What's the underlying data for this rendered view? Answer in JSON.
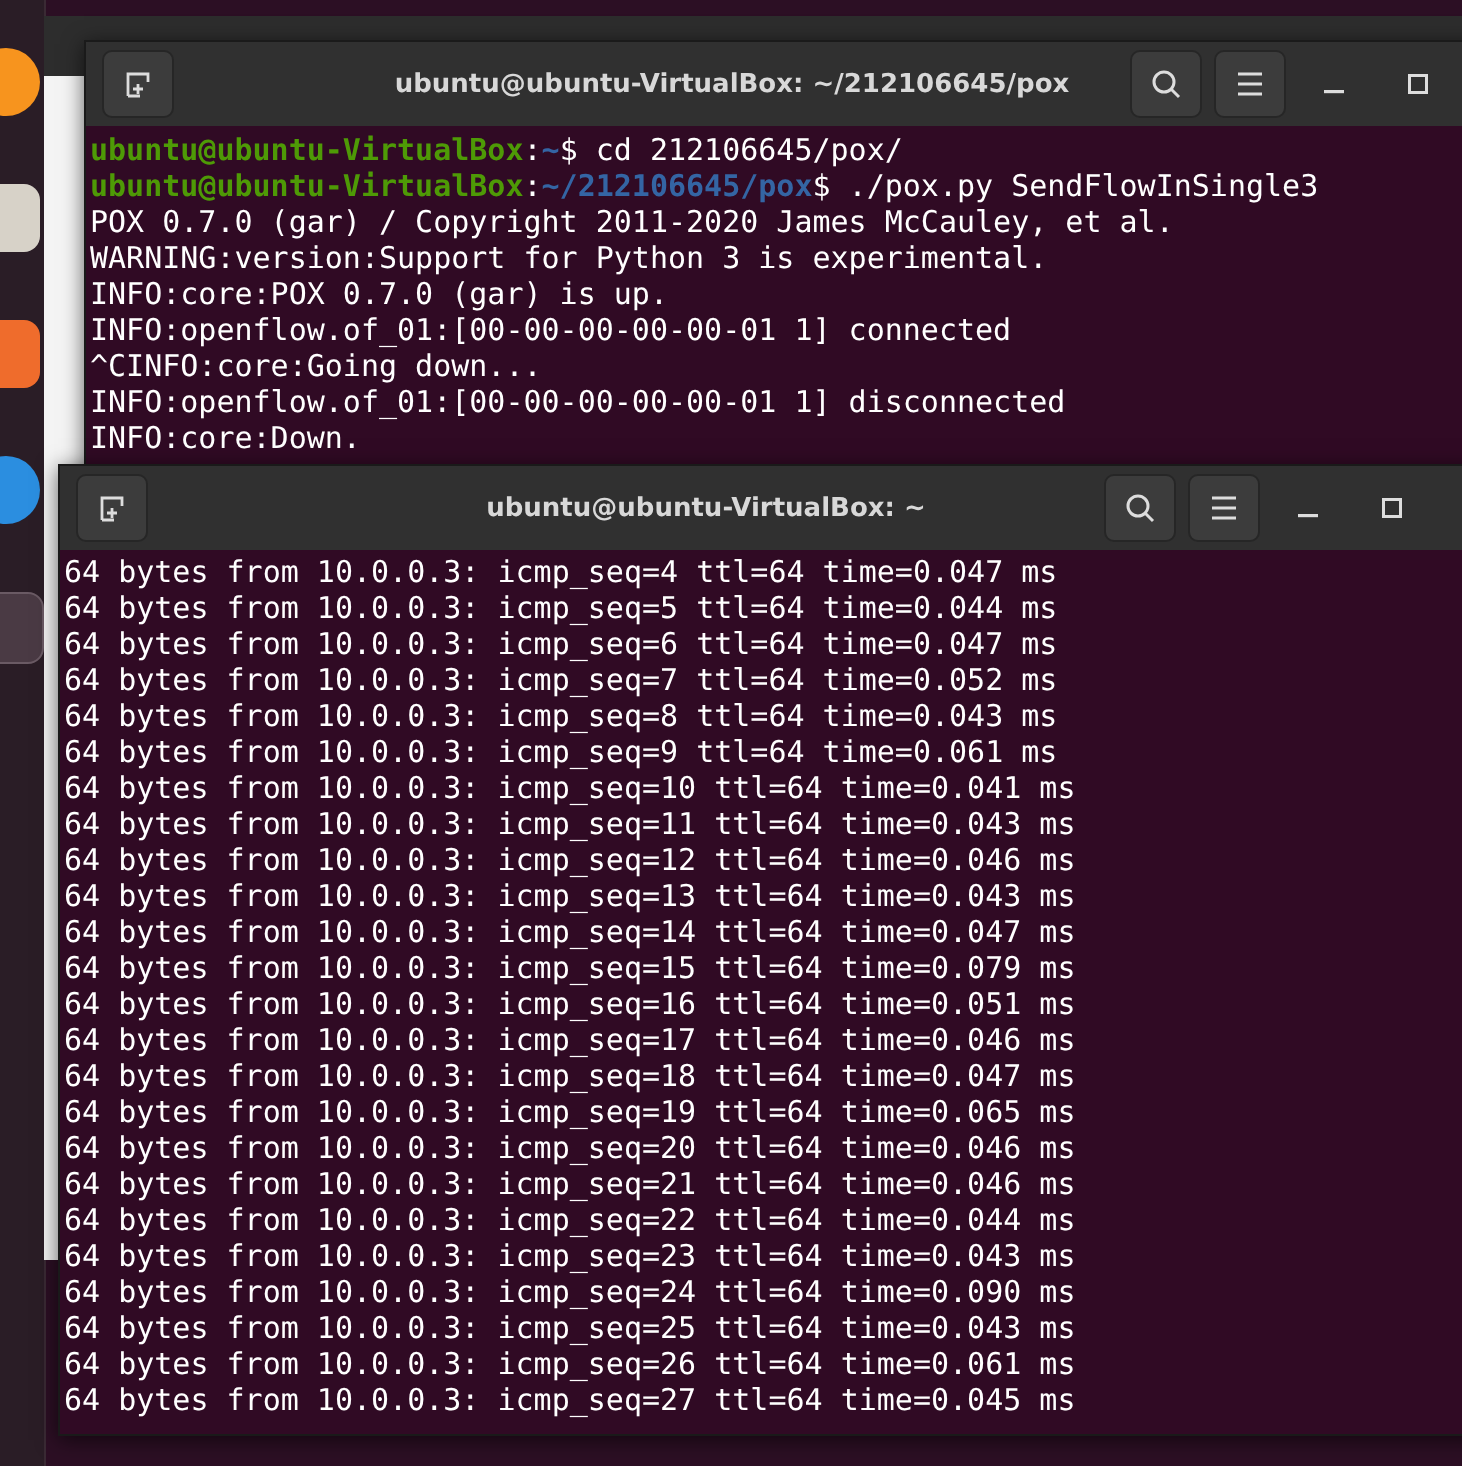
{
  "back_terminal": {
    "title": "ubuntu@ubuntu-VirtualBox: ~/212106645/pox",
    "lines": [
      [
        {
          "kind": "user",
          "text": "ubuntu@ubuntu-VirtualBox"
        },
        {
          "kind": "plain",
          "text": ":"
        },
        {
          "kind": "path",
          "text": "~"
        },
        {
          "kind": "plain",
          "text": "$ cd 212106645/pox/"
        }
      ],
      [
        {
          "kind": "user",
          "text": "ubuntu@ubuntu-VirtualBox"
        },
        {
          "kind": "plain",
          "text": ":"
        },
        {
          "kind": "path",
          "text": "~/212106645/pox"
        },
        {
          "kind": "plain",
          "text": "$ ./pox.py SendFlowInSingle3"
        }
      ],
      [
        {
          "kind": "plain",
          "text": "POX 0.7.0 (gar) / Copyright 2011-2020 James McCauley, et al."
        }
      ],
      [
        {
          "kind": "plain",
          "text": "WARNING:version:Support for Python 3 is experimental."
        }
      ],
      [
        {
          "kind": "plain",
          "text": "INFO:core:POX 0.7.0 (gar) is up."
        }
      ],
      [
        {
          "kind": "plain",
          "text": "INFO:openflow.of_01:[00-00-00-00-00-01 1] connected"
        }
      ],
      [
        {
          "kind": "plain",
          "text": "^CINFO:core:Going down..."
        }
      ],
      [
        {
          "kind": "plain",
          "text": "INFO:openflow.of_01:[00-00-00-00-00-01 1] disconnected"
        }
      ],
      [
        {
          "kind": "plain",
          "text": "INFO:core:Down."
        }
      ]
    ]
  },
  "front_terminal": {
    "title": "ubuntu@ubuntu-VirtualBox: ~",
    "lines": [
      "64 bytes from 10.0.0.3: icmp_seq=4 ttl=64 time=0.047 ms",
      "64 bytes from 10.0.0.3: icmp_seq=5 ttl=64 time=0.044 ms",
      "64 bytes from 10.0.0.3: icmp_seq=6 ttl=64 time=0.047 ms",
      "64 bytes from 10.0.0.3: icmp_seq=7 ttl=64 time=0.052 ms",
      "64 bytes from 10.0.0.3: icmp_seq=8 ttl=64 time=0.043 ms",
      "64 bytes from 10.0.0.3: icmp_seq=9 ttl=64 time=0.061 ms",
      "64 bytes from 10.0.0.3: icmp_seq=10 ttl=64 time=0.041 ms",
      "64 bytes from 10.0.0.3: icmp_seq=11 ttl=64 time=0.043 ms",
      "64 bytes from 10.0.0.3: icmp_seq=12 ttl=64 time=0.046 ms",
      "64 bytes from 10.0.0.3: icmp_seq=13 ttl=64 time=0.043 ms",
      "64 bytes from 10.0.0.3: icmp_seq=14 ttl=64 time=0.047 ms",
      "64 bytes from 10.0.0.3: icmp_seq=15 ttl=64 time=0.079 ms",
      "64 bytes from 10.0.0.3: icmp_seq=16 ttl=64 time=0.051 ms",
      "64 bytes from 10.0.0.3: icmp_seq=17 ttl=64 time=0.046 ms",
      "64 bytes from 10.0.0.3: icmp_seq=18 ttl=64 time=0.047 ms",
      "64 bytes from 10.0.0.3: icmp_seq=19 ttl=64 time=0.065 ms",
      "64 bytes from 10.0.0.3: icmp_seq=20 ttl=64 time=0.046 ms",
      "64 bytes from 10.0.0.3: icmp_seq=21 ttl=64 time=0.046 ms",
      "64 bytes from 10.0.0.3: icmp_seq=22 ttl=64 time=0.044 ms",
      "64 bytes from 10.0.0.3: icmp_seq=23 ttl=64 time=0.043 ms",
      "64 bytes from 10.0.0.3: icmp_seq=24 ttl=64 time=0.090 ms",
      "64 bytes from 10.0.0.3: icmp_seq=25 ttl=64 time=0.043 ms",
      "64 bytes from 10.0.0.3: icmp_seq=26 ttl=64 time=0.061 ms",
      "64 bytes from 10.0.0.3: icmp_seq=27 ttl=64 time=0.045 ms"
    ]
  }
}
